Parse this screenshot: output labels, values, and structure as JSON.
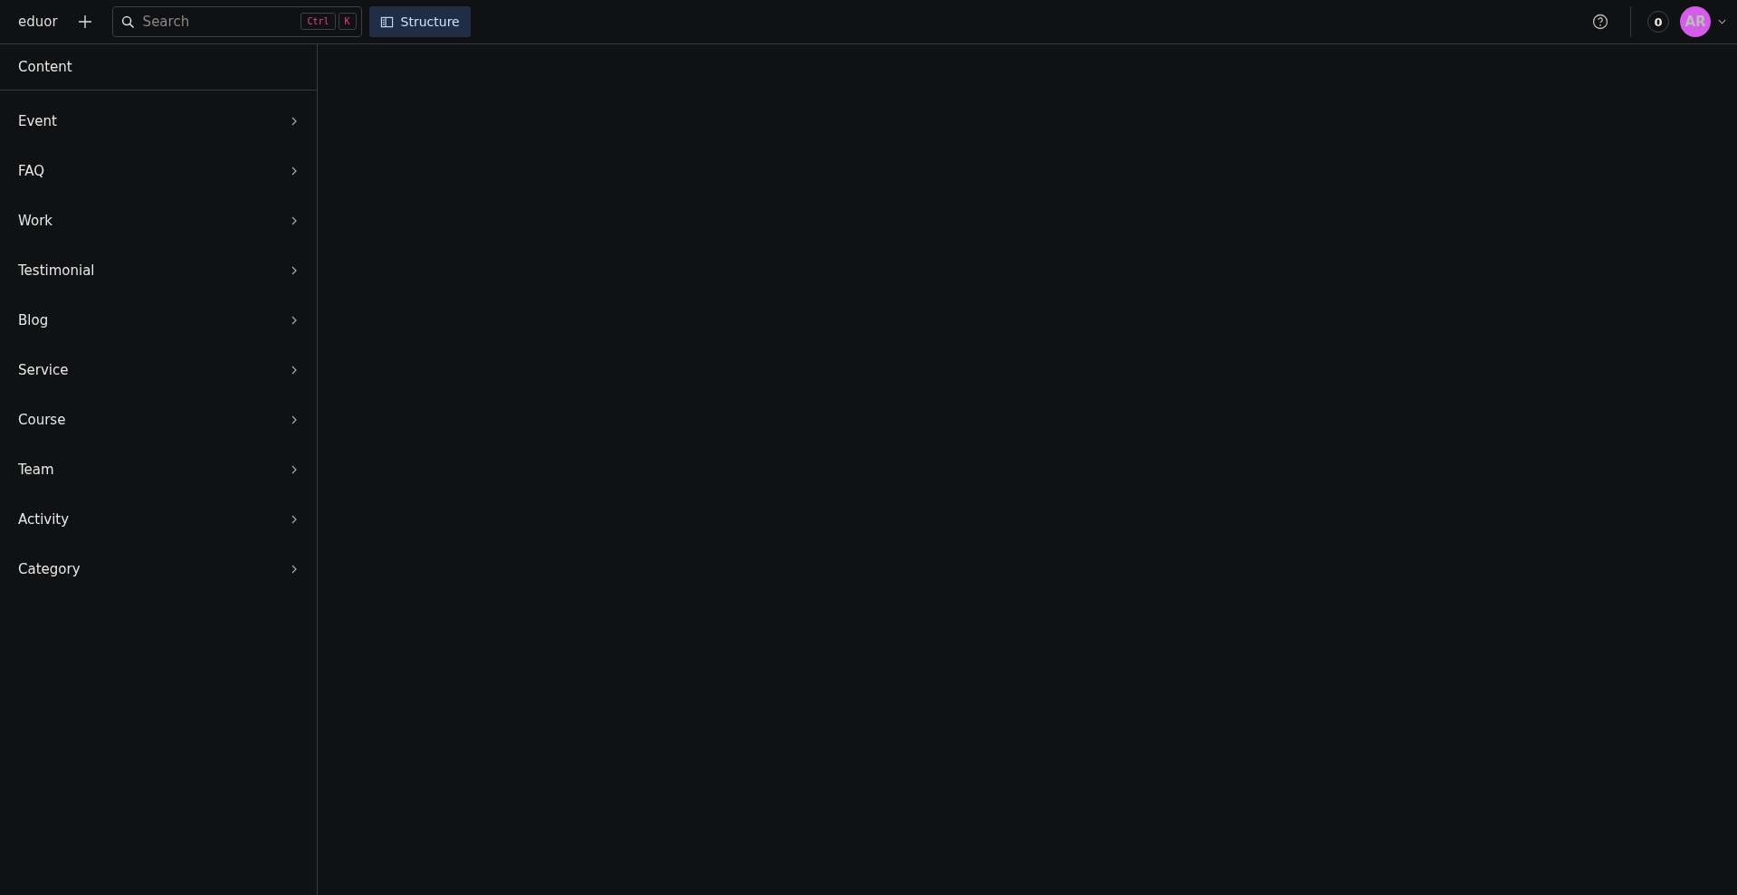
{
  "topbar": {
    "workspace": "eduor",
    "search": {
      "placeholder": "Search",
      "shortcut": [
        "Ctrl",
        "K"
      ]
    },
    "tools": [
      {
        "label": "Structure",
        "selected": true
      }
    ],
    "notifications": "0",
    "avatar": {
      "initials": "AR",
      "color": "#d45ce8"
    }
  },
  "sidebar": {
    "title": "Content",
    "items": [
      {
        "label": "Event"
      },
      {
        "label": "FAQ"
      },
      {
        "label": "Work"
      },
      {
        "label": "Testimonial"
      },
      {
        "label": "Blog"
      },
      {
        "label": "Service"
      },
      {
        "label": "Course"
      },
      {
        "label": "Team"
      },
      {
        "label": "Activity"
      },
      {
        "label": "Category"
      }
    ]
  }
}
